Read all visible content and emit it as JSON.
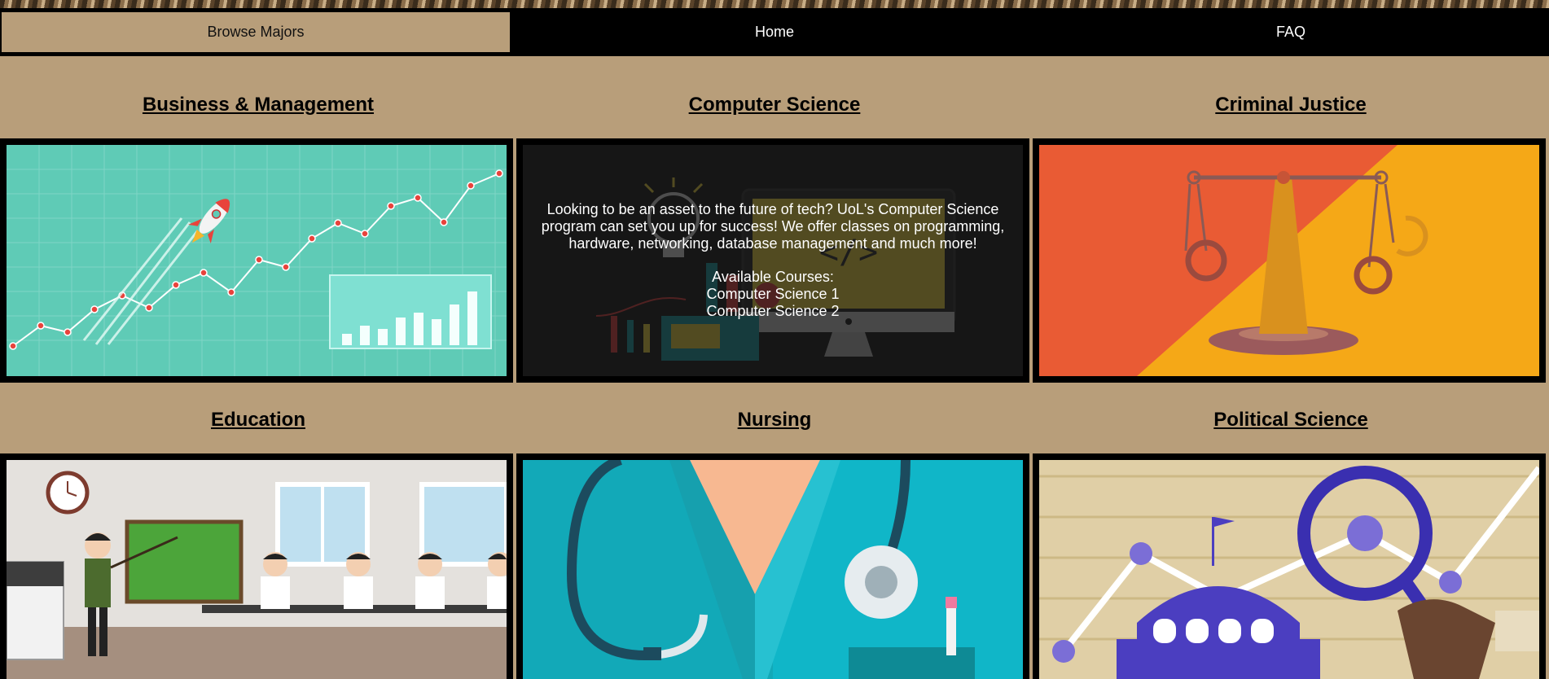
{
  "nav": {
    "items": [
      {
        "label": "Browse Majors",
        "active": true
      },
      {
        "label": "Home",
        "active": false
      },
      {
        "label": "FAQ",
        "active": false
      }
    ]
  },
  "majors": [
    {
      "title": "Business & Management",
      "image": "rocket-growth-chart"
    },
    {
      "title": "Computer Science",
      "image": "tech-lab-computer",
      "description": "Looking to be an asset to the future of tech? UoL's Computer Science program can set you up for success! We offer classes on programming, hardware, networking, database management and much more!",
      "courses_heading": "Available Courses:",
      "courses": [
        "Computer Science 1",
        "Computer Science 2"
      ]
    },
    {
      "title": "Criminal Justice",
      "image": "scales-handcuffs"
    },
    {
      "title": "Education",
      "image": "classroom-teacher"
    },
    {
      "title": "Nursing",
      "image": "stethoscope-scrubs"
    },
    {
      "title": "Political Science",
      "image": "capitol-magnifier"
    }
  ],
  "colors": {
    "page_bg": "#b89e7a",
    "nav_bg": "#000000",
    "active_nav_bg": "#b89e7a"
  }
}
